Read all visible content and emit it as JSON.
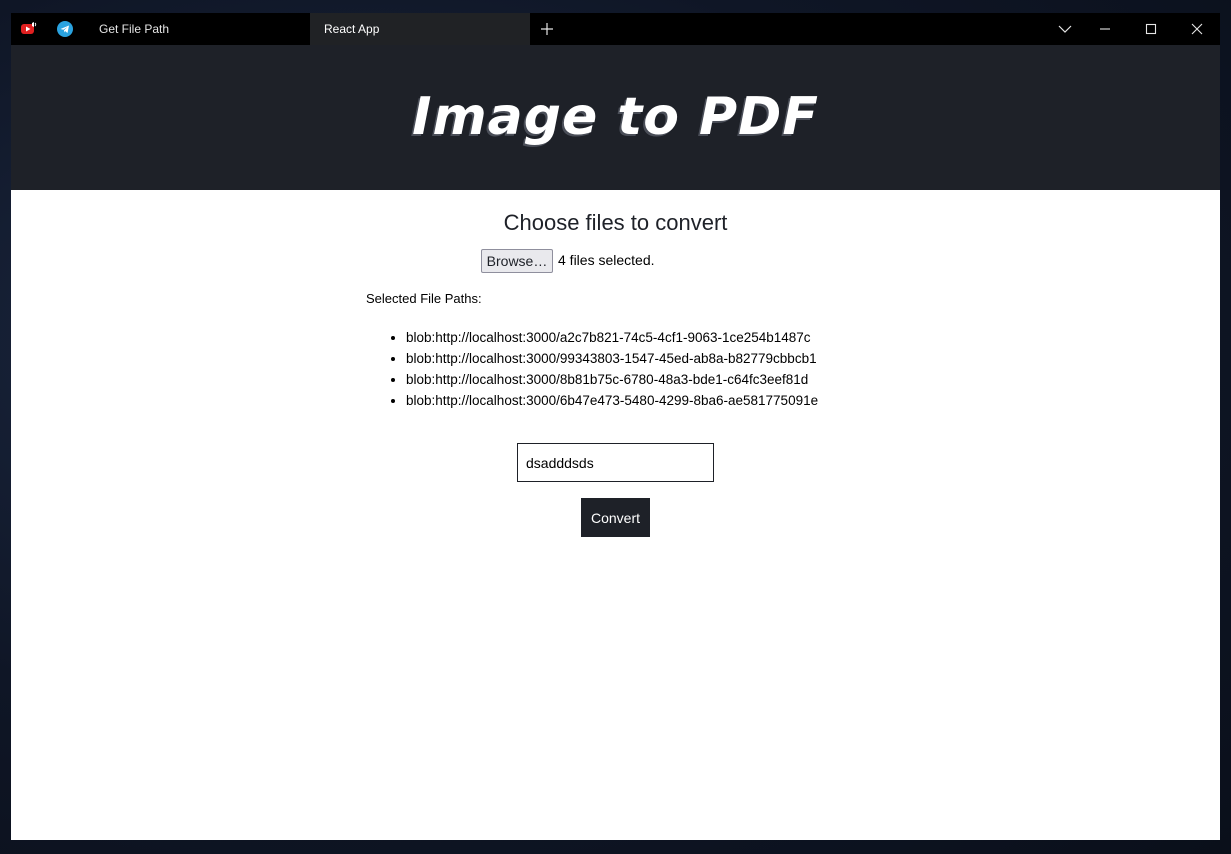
{
  "browser": {
    "tabs": [
      {
        "label": "Get File Path",
        "active": false
      },
      {
        "label": "React App",
        "active": true
      }
    ],
    "icons": [
      "youtube-icon",
      "telegram-icon",
      "plus-icon",
      "chevron-down-icon",
      "minimize-icon",
      "maximize-icon",
      "close-icon"
    ]
  },
  "header": {
    "title": "Image to PDF",
    "background": "#1e2128"
  },
  "main": {
    "heading": "Choose files to convert",
    "browse_label": "Browse…",
    "files_selected": "4 files selected.",
    "paths_label": "Selected File Paths:",
    "paths": [
      "blob:http://localhost:3000/a2c7b821-74c5-4cf1-9063-1ce254b1487c",
      "blob:http://localhost:3000/99343803-1547-45ed-ab8a-b82779cbbcb1",
      "blob:http://localhost:3000/8b81b75c-6780-48a3-bde1-c64fc3eef81d",
      "blob:http://localhost:3000/6b47e473-5480-4299-8ba6-ae581775091e"
    ],
    "filename_value": "dsadddsds",
    "convert_label": "Convert"
  }
}
